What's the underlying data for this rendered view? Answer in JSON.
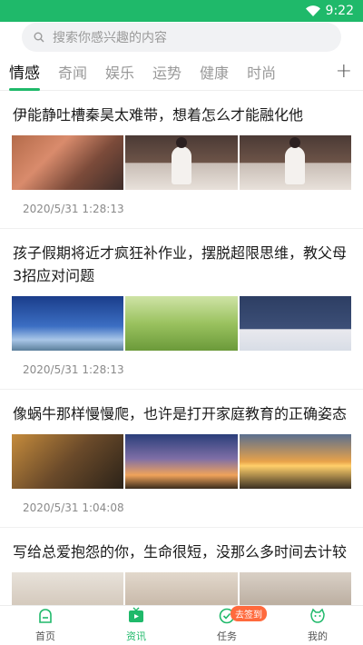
{
  "status_bar": {
    "time": "9:22",
    "bg_color": "#1fb96a"
  },
  "search": {
    "placeholder": "搜索你感兴趣的内容"
  },
  "tabs": [
    {
      "label": "情感",
      "active": true
    },
    {
      "label": "奇闻",
      "active": false
    },
    {
      "label": "娱乐",
      "active": false
    },
    {
      "label": "运势",
      "active": false
    },
    {
      "label": "健康",
      "active": false
    },
    {
      "label": "时尚",
      "active": false
    }
  ],
  "tab_add": "+",
  "articles": [
    {
      "title": "伊能静吐槽秦昊太难带，想着怎么才能融化他",
      "time": "2020/5/31 1:28:13"
    },
    {
      "title": "孩子假期将近才疯狂补作业，摆脱超限思维，教父母3招应对问题",
      "time": "2020/5/31 1:28:13"
    },
    {
      "title": "像蜗牛那样慢慢爬，也许是打开家庭教育的正确姿态",
      "time": "2020/5/31 1:04:08"
    },
    {
      "title": "写给总爱抱怨的你，生命很短，没那么多时间去计较",
      "time": ""
    }
  ],
  "bottom_nav": [
    {
      "label": "首页",
      "icon": "home-icon",
      "active": false
    },
    {
      "label": "资讯",
      "icon": "tv-icon",
      "active": true
    },
    {
      "label": "任务",
      "icon": "task-icon",
      "active": false,
      "badge": "去签到"
    },
    {
      "label": "我的",
      "icon": "profile-icon",
      "active": false
    }
  ],
  "colors": {
    "accent": "#1fb96a",
    "badge": "#ff6a3d"
  }
}
